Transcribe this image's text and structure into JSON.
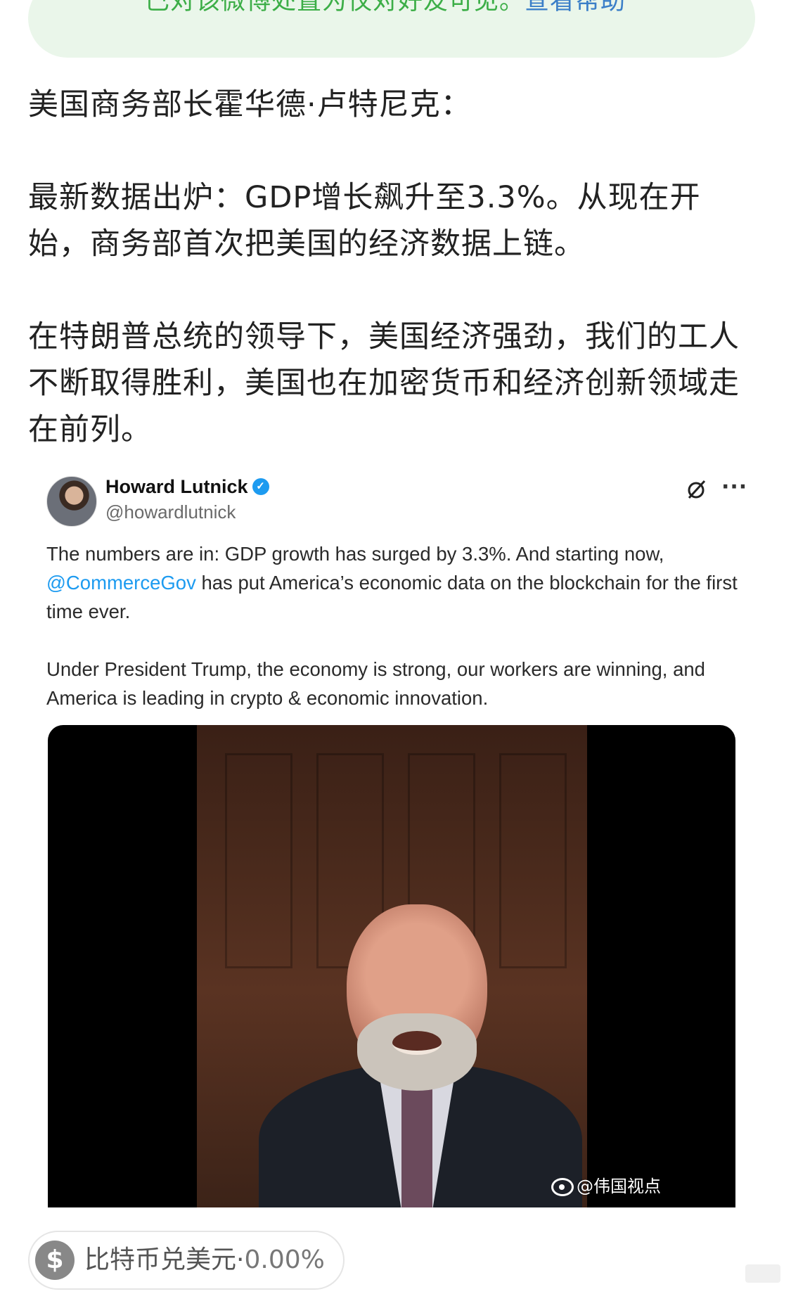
{
  "notice": {
    "text": "已对该微博处置为仅对好友可见。",
    "link": "查看帮助",
    "icon": "lightning-shield-icon"
  },
  "post": {
    "line1": "美国商务部长霍华德·卢特尼克：",
    "para2": "最新数据出炉：GDP增长飙升至3.3%。从现在开始，商务部首次把美国的经济数据上链。",
    "para3": "在特朗普总统的领导下，美国经济强劲，我们的工人不断取得胜利，美国也在加密货币和经济创新领域走在前列。"
  },
  "tweet": {
    "name": "Howard Lutnick",
    "handle": "@howardlutnick",
    "verified_icon": "verified-badge-icon",
    "grok_icon": "grok-icon",
    "more_icon": "more-icon",
    "body_part1": "The numbers are in: GDP growth has surged by 3.3%. And starting now, ",
    "mention": "@CommerceGov",
    "body_part2": " has put America’s economic data on the blockchain for the first time ever.",
    "body_para2": "Under President Trump, the economy is strong, our workers are winning, and America is leading in crypto & economic innovation.",
    "watermark": "@伟国视点"
  },
  "chip": {
    "icon": "dollar-icon",
    "label": "比特币兑美元",
    "separator": "·",
    "value": "0.00%"
  },
  "colors": {
    "notice_bg": "#eaf6ea",
    "notice_text": "#3cae47",
    "link": "#3b7fc8",
    "mention": "#1d9bf0"
  }
}
